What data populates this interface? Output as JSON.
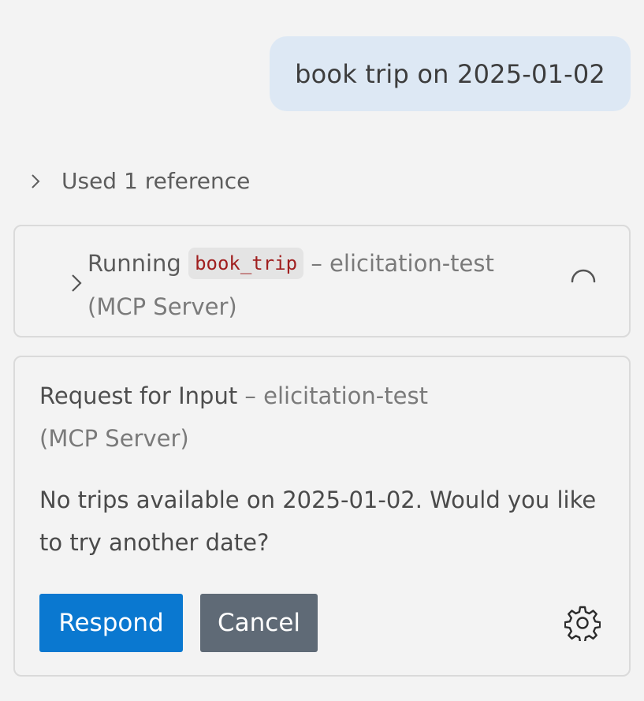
{
  "user_message": {
    "text": "book trip on 2025-01-02"
  },
  "references": {
    "label": "Used 1 reference"
  },
  "tool_call": {
    "status_label": "Running",
    "tool_name": "book_trip",
    "source": "– elicitation-test (MCP Server)",
    "state": "in-progress"
  },
  "elicitation": {
    "title": "Request for Input",
    "source": "– elicitation-test (MCP Server)",
    "message": "No trips available on 2025-01-02. Would you like to try another date?",
    "respond_label": "Respond",
    "cancel_label": "Cancel",
    "settings_icon": "gear-icon"
  },
  "colors": {
    "background": "#f3f3f3",
    "user_bubble": "#dde8f4",
    "primary_button": "#0a78d0",
    "secondary_button": "#5f6a76",
    "code_text": "#a01f1f"
  }
}
